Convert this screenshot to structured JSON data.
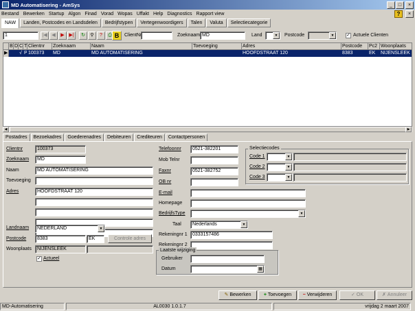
{
  "window": {
    "title": "MD Automatisering - AmSys"
  },
  "menu": [
    "Bestand",
    "Bewerken",
    "Startup",
    "Algon",
    "Finad",
    "Vorad",
    "Wopas",
    "Uffakt",
    "Help",
    "Diagnostics",
    "Rapport view"
  ],
  "tabs": [
    "NAW",
    "Landen, Postcodes en Landsdelen",
    "Bedrijfstypen",
    "Vertegenwoordigers",
    "Talen",
    "Valuta",
    "Selectiecategorie"
  ],
  "toolbar": {
    "record": "1",
    "clientnr_label": "ClientNr",
    "clientnr_value": "",
    "zoeknaam_label": "Zoeknaam",
    "zoeknaam_value": "MD",
    "land_label": "Land",
    "land_value": "",
    "postcode_label": "Postcode",
    "postcode_value": "",
    "actuele_label": "Actuele Clienten",
    "actuele_checked": true
  },
  "grid": {
    "columns": [
      "B",
      "D",
      "C",
      "T",
      "Clientnr",
      "Zoeknaam",
      "Naam",
      "Toevoeging",
      "Adres",
      "Postcode",
      "Pc2",
      "Woonplaats"
    ],
    "rows": [
      [
        "",
        "",
        "√",
        "P",
        "100373",
        "MD",
        "MD AUTOMATISERING",
        "",
        "HOOFDSTRAAT 120",
        "8383",
        "EK",
        "NIJENSLEEK"
      ]
    ]
  },
  "subtabs": [
    "Postadres",
    "Bezoekadres",
    "Goederenadres",
    "Debiteuren",
    "Crediteuren",
    "Contactpersonen"
  ],
  "form": {
    "clientnr_label": "Clientnr",
    "clientnr": "100373",
    "zoeknaam_label": "Zoeknaam",
    "zoeknaam": "MD",
    "naam_label": "Naam",
    "naam": "MD AUTOMATISERING",
    "toevoeging_label": "Toevoeging",
    "toevoeging": "",
    "adres_label": "Adres",
    "adres1": "HOOFDSTRAAT 120",
    "adres2": "",
    "adres3": "",
    "adres4": "",
    "adres5": "",
    "landnaam_label": "Landnaam",
    "landnaam": "NEDERLAND",
    "postcode_label": "Postcode",
    "postcode": "8383",
    "postcode2": "EK",
    "controle_label": "Controle adres",
    "woonplaats_label": "Woonplaats",
    "woonplaats": "NIJENSLEEK",
    "actueel_label": "Actueel",
    "actueel_checked": true,
    "telefoon_label": "Telefoonnr",
    "telefoon": "0521-382201",
    "mobiel_label": "Mob Telnr",
    "mobiel": "",
    "fax_label": "Faxnr",
    "fax": "0521-382752",
    "ob_label": "OB nr",
    "ob": "",
    "email_label": "E-mail",
    "email": "",
    "homepage_label": "Homepage",
    "homepage": "",
    "bedrijfstype_label": "BedrijfsType",
    "bedrijfstype": "",
    "taal_label": "Taal",
    "taal": "Nederlands",
    "rek1_label": "Rekeningnr 1",
    "rek1": "0333157486",
    "rek2_label": "Rekeningnr 2",
    "rek2": "",
    "selectiecodes_title": "Selectiecodes",
    "code1_label": "Code 1",
    "code2_label": "Code 2",
    "code3_label": "Code 3",
    "laatste_title": "Laatste wijziging",
    "gebruiker_label": "Gebruiker",
    "gebruiker": "",
    "datum_label": "Datum",
    "datum": ""
  },
  "buttons": {
    "bewerken": "Bewerken",
    "toevoegen": "Toevoegen",
    "verwijderen": "Verwijderen",
    "ok": "OK",
    "annuleer": "Annuleer"
  },
  "status": {
    "company": "MD-Automatisering",
    "version": "AL0030 1.0.1.7",
    "date": "vrijdag 2 maart 2007"
  }
}
